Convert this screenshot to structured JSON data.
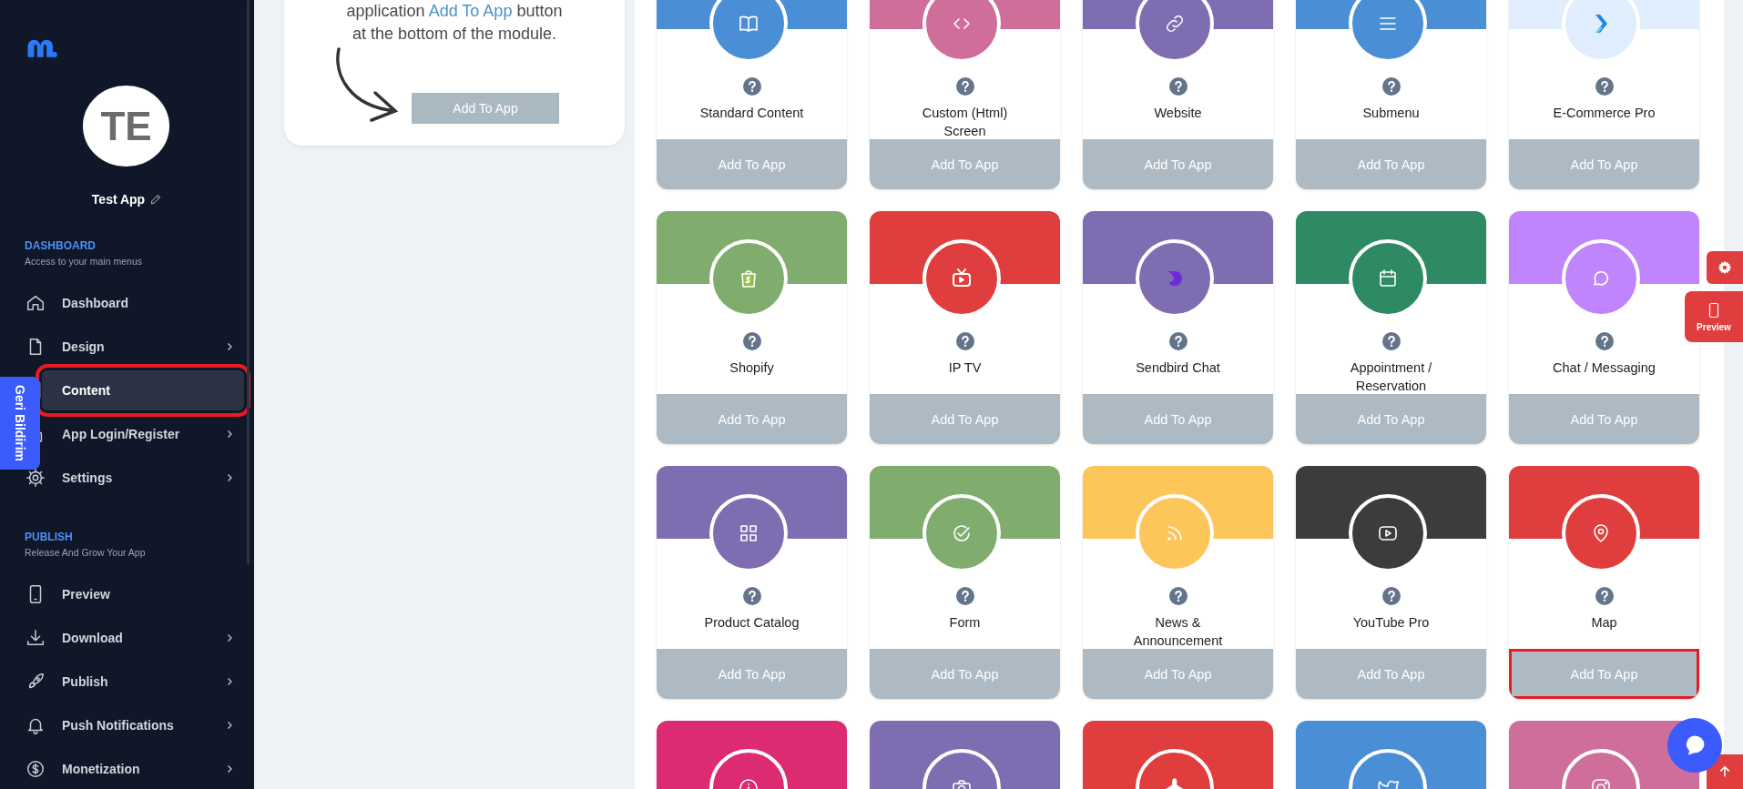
{
  "sidebar": {
    "avatar": "TE",
    "app_name": "Test App",
    "sections": [
      {
        "title": "DASHBOARD",
        "subtitle": "Access to your main menus",
        "items": [
          {
            "label": "Dashboard",
            "has_submenu": false,
            "selected": false,
            "highlighted": false
          },
          {
            "label": "Design",
            "has_submenu": true,
            "selected": false,
            "highlighted": false
          },
          {
            "label": "Content",
            "has_submenu": false,
            "selected": true,
            "highlighted": true
          },
          {
            "label": "App Login/Register",
            "has_submenu": true,
            "selected": false,
            "highlighted": false
          },
          {
            "label": "Settings",
            "has_submenu": true,
            "selected": false,
            "highlighted": false
          }
        ]
      },
      {
        "title": "PUBLISH",
        "subtitle": "Release And Grow Your App",
        "items": [
          {
            "label": "Preview",
            "has_submenu": false,
            "selected": false,
            "highlighted": false
          },
          {
            "label": "Download",
            "has_submenu": true,
            "selected": false,
            "highlighted": false
          },
          {
            "label": "Publish",
            "has_submenu": true,
            "selected": false,
            "highlighted": false
          },
          {
            "label": "Push Notifications",
            "has_submenu": true,
            "selected": false,
            "highlighted": false
          },
          {
            "label": "Monetization",
            "has_submenu": true,
            "selected": false,
            "highlighted": false
          }
        ]
      }
    ]
  },
  "feedback_tab": "Geri Bildirim",
  "guide_card": {
    "line1_before": "application",
    "line1_link": "Add To App",
    "line1_after": "button",
    "line2": "at the bottom of the module.",
    "button": "Add To App"
  },
  "modules": [
    {
      "name": "Standard Content",
      "color": "#4a8fd6",
      "button": "Add To App",
      "highlighted": false
    },
    {
      "name": "Custom (Html) Screen",
      "color": "#cf6e9b",
      "button": "Add To App",
      "highlighted": false
    },
    {
      "name": "Website",
      "color": "#7e6db0",
      "button": "Add To App",
      "highlighted": false
    },
    {
      "name": "Submenu",
      "color": "#4a8fd6",
      "button": "Add To App",
      "highlighted": false
    },
    {
      "name": "E-Commerce Pro",
      "color": "#e0edfc",
      "button": "Add To App",
      "highlighted": false
    },
    {
      "name": "Shopify",
      "color": "#80ad6e",
      "button": "Add To App",
      "highlighted": false
    },
    {
      "name": "IP TV",
      "color": "#e03e3e",
      "button": "Add To App",
      "highlighted": false
    },
    {
      "name": "Sendbird Chat",
      "color": "#7e6db0",
      "button": "Add To App",
      "highlighted": false
    },
    {
      "name": "Appointment / Reservation",
      "color": "#2e8a62",
      "button": "Add To App",
      "highlighted": false
    },
    {
      "name": "Chat / Messaging",
      "color": "#c084fc",
      "button": "Add To App",
      "highlighted": false
    },
    {
      "name": "Product Catalog",
      "color": "#7e6db0",
      "button": "Add To App",
      "highlighted": false
    },
    {
      "name": "Form",
      "color": "#80ad6e",
      "button": "Add To App",
      "highlighted": false
    },
    {
      "name": "News & Announcement",
      "color": "#fcc65a",
      "button": "Add To App",
      "highlighted": false
    },
    {
      "name": "YouTube Pro",
      "color": "#3c3c3c",
      "button": "Add To App",
      "highlighted": false
    },
    {
      "name": "Map",
      "color": "#e03e3e",
      "button": "Add To App",
      "highlighted": true
    },
    {
      "color": "#dc2a73"
    },
    {
      "color": "#7e6db0"
    },
    {
      "color": "#e03e3e"
    },
    {
      "color": "#4a8fd6"
    },
    {
      "color": "#cf6e9b"
    }
  ],
  "floating": {
    "preview": "Preview"
  }
}
